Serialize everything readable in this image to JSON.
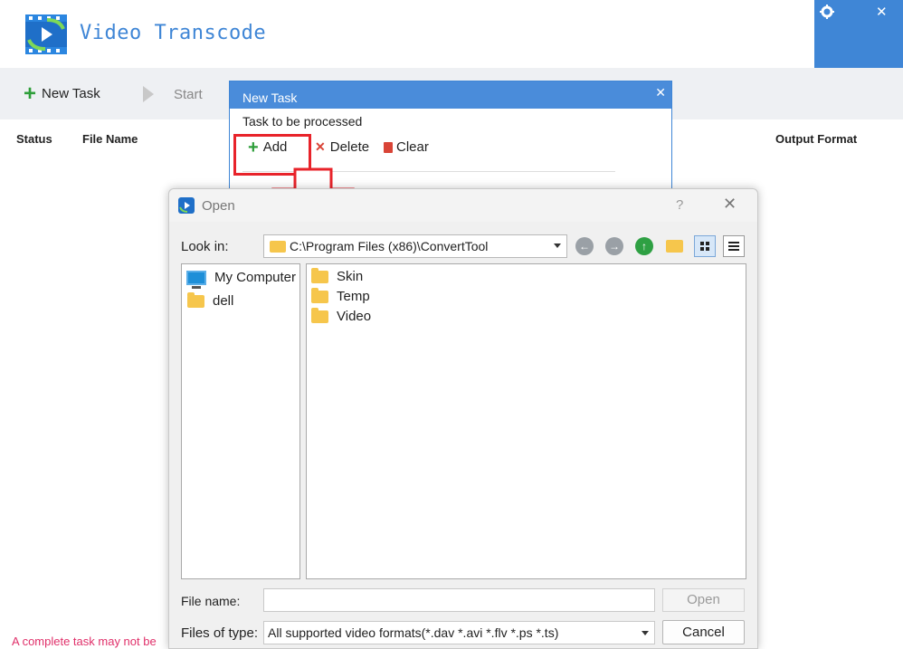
{
  "app": {
    "title": "Video Transcode",
    "accent_color": "#3f86d6",
    "settings_icon": "gear-icon",
    "close_icon": "close-icon",
    "close_glyph": "✕"
  },
  "toolbar": {
    "new_task_label": "New Task",
    "start_label": "Start"
  },
  "table": {
    "columns": [
      "Status",
      "File Name",
      "Output Format"
    ]
  },
  "footer": {
    "note": "A complete task may not be"
  },
  "new_task_dialog": {
    "title": "New Task",
    "close_glyph": "✕",
    "subtitle": "Task to be processed",
    "add_label": "Add",
    "delete_label": "Delete",
    "clear_label": "Clear",
    "highlight_color": "#e8232a"
  },
  "open_dialog": {
    "title": "Open",
    "help_glyph": "?",
    "close_glyph": "✕",
    "look_in_label": "Look in:",
    "look_in_value": "C:\\Program Files (x86)\\ConvertTool",
    "nav_icons": [
      "back-icon",
      "forward-icon",
      "up-icon",
      "new-folder-icon",
      "icon-view-icon",
      "detail-view-icon"
    ],
    "places": [
      {
        "label": "My Computer",
        "icon": "computer-icon"
      },
      {
        "label": "dell",
        "icon": "folder-icon"
      }
    ],
    "files": [
      {
        "label": "Skin",
        "icon": "folder-icon"
      },
      {
        "label": "Temp",
        "icon": "folder-icon"
      },
      {
        "label": "Video",
        "icon": "folder-icon"
      }
    ],
    "file_name_label": "File name:",
    "file_name_value": "",
    "open_label": "Open",
    "files_of_type_label": "Files of type:",
    "files_of_type_value": "All supported video formats(*.dav *.avi *.flv *.ps *.ts)",
    "cancel_label": "Cancel"
  }
}
